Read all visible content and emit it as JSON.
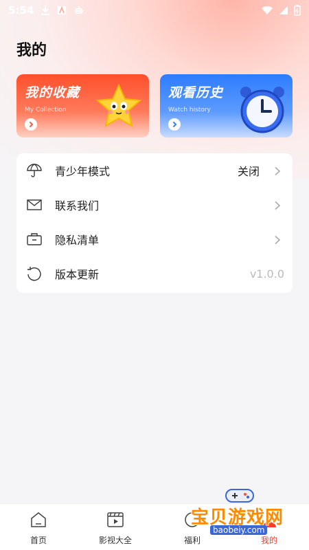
{
  "status_bar": {
    "time": "5:54"
  },
  "page": {
    "title": "我的"
  },
  "cards": {
    "favorites": {
      "title": "我的收藏",
      "subtitle": "My Collection"
    },
    "history": {
      "title": "观看历史",
      "subtitle": "Watch history"
    }
  },
  "menu": {
    "items": [
      {
        "label": "青少年模式",
        "value": "关闭",
        "icon": "umbrella-icon"
      },
      {
        "label": "联系我们",
        "icon": "mail-icon"
      },
      {
        "label": "隐私清单",
        "icon": "briefcase-icon"
      },
      {
        "label": "版本更新",
        "value": "v1.0.0",
        "icon": "refresh-icon"
      }
    ]
  },
  "tabs": [
    {
      "label": "首页",
      "icon": "home-icon"
    },
    {
      "label": "影视大全",
      "icon": "film-icon"
    },
    {
      "label": "福利",
      "icon": "gift-icon"
    },
    {
      "label": "我的",
      "icon": "user-icon",
      "active": true
    }
  ],
  "watermark": {
    "text": "宝贝游戏网",
    "url": "baobeiy.com"
  },
  "colors": {
    "accent": "#ff3b2f",
    "fav_card": "#ff4f2b",
    "history_card": "#2c7cff",
    "version_text": "#bbbbbb"
  }
}
